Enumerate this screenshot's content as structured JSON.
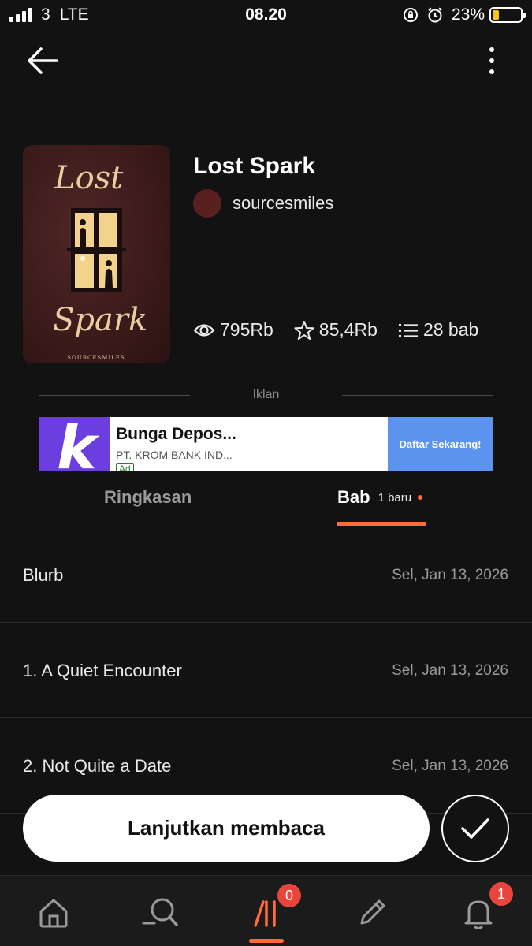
{
  "status_bar": {
    "carrier": "3",
    "network": "LTE",
    "time": "08.20",
    "battery": "23%",
    "battery_level": 0.23,
    "icons": [
      "signal-icon",
      "lock-rotation-icon",
      "alarm-icon",
      "battery-icon"
    ]
  },
  "top_bar": {
    "icons": [
      "back-arrow-icon",
      "more-vertical-icon"
    ]
  },
  "book": {
    "cover_title_top": "Lost",
    "cover_title_bottom": "Spark",
    "cover_author": "SOURCESMILES",
    "title": "Lost Spark",
    "author": "sourcesmiles",
    "reads": "795Rb",
    "votes": "85,4Rb",
    "parts": "28 bab"
  },
  "ad": {
    "label": "Iklan",
    "logo_letter": "k",
    "headline": "Bunga Depos...",
    "advertiser": "PT. KROM BANK IND...",
    "badge": "Ad",
    "cta": "Daftar Sekarang!",
    "colors": {
      "logo_bg": "#6b3ee0",
      "cta_bg": "#5b93ee"
    }
  },
  "tabs": {
    "summary": "Ringkasan",
    "chapters": "Bab",
    "chapters_new": "1 baru",
    "active": "chapters"
  },
  "chapters": [
    {
      "title": "Blurb",
      "date": "Sel, Jan 13, 2026"
    },
    {
      "title": "1. A Quiet Encounter",
      "date": "Sel, Jan 13, 2026"
    },
    {
      "title": "2. Not Quite a Date",
      "date": "Sel, Jan 13, 2026"
    }
  ],
  "actions": {
    "continue_label": "Lanjutkan membaca"
  },
  "bottom_nav": {
    "items": [
      "home-icon",
      "search-icon",
      "library-icon",
      "write-icon",
      "notifications-icon"
    ],
    "library_badge": "0",
    "notifications_badge": "1",
    "active": "library"
  },
  "colors": {
    "background": "#121212",
    "accent": "#ff6b3d",
    "badge": "#e8453c"
  }
}
